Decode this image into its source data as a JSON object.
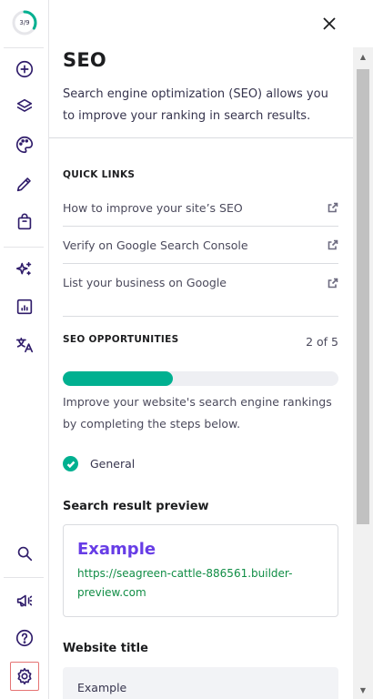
{
  "rail": {
    "progress_text": "3/9",
    "progress_fraction": 0.333,
    "icons": [
      "add-icon",
      "layers-icon",
      "palette-icon",
      "pen-icon",
      "shopping-bag-icon",
      "sparkles-icon",
      "analytics-icon",
      "translate-icon",
      "search-icon",
      "megaphone-icon",
      "help-icon",
      "settings-icon"
    ],
    "active_item": "settings-icon"
  },
  "panel": {
    "title": "SEO",
    "description": "Search engine optimization (SEO) allows you to improve your ranking in search results.",
    "quick_links": {
      "label": "QUICK LINKS",
      "items": [
        "How to improve your site’s SEO",
        "Verify on Google Search Console",
        "List your business on Google"
      ]
    },
    "opportunities": {
      "label": "SEO OPPORTUNITIES",
      "count": "2 of 5",
      "progress_fraction": 0.4,
      "text": "Improve your website's search engine rankings by completing the steps below.",
      "completed_step": "General"
    },
    "preview": {
      "heading": "Search result preview",
      "title": "Example",
      "url": "https://seagreen-cattle-886561.builder-preview.com"
    },
    "website_title": {
      "label": "Website title",
      "value": "Example"
    }
  },
  "colors": {
    "accent": "#673de6",
    "success": "#00b090",
    "url_green": "#108d45",
    "rail_icon": "#2f1c6a"
  }
}
